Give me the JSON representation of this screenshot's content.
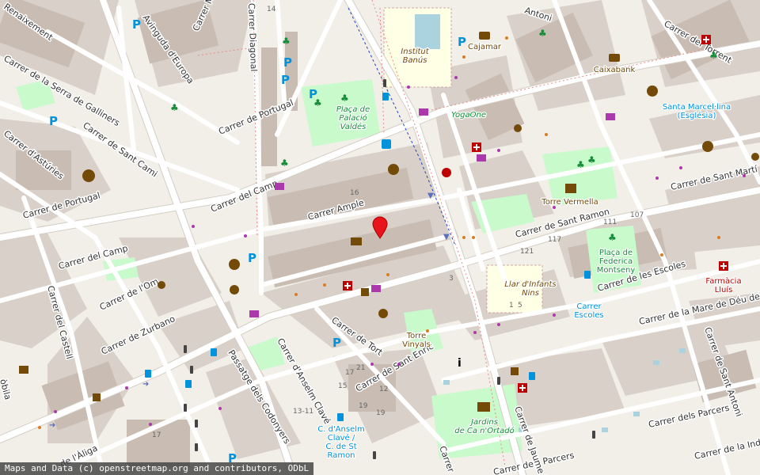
{
  "colors": {
    "background": "#f2efe9",
    "block": "#d9d0c9",
    "building": "#c9bdb3",
    "road": "#ffffff",
    "road_casing": "#d4cdc4",
    "park": "#c8facc",
    "school": "#ffffe5",
    "water": "#aad3df",
    "poi_blue": "#0092da",
    "poi_green": "#198c3a",
    "poi_brown": "#734a08",
    "health_red": "#bf0000",
    "marker_red": "#e8141b",
    "street_text": "#333333"
  },
  "streets": [
    {
      "id": "renaixement",
      "text": "Renaixement"
    },
    {
      "id": "avinguda-europa",
      "text": "Avinguda d'Europa"
    },
    {
      "id": "carrer-me",
      "text": "Carrer Me"
    },
    {
      "id": "carrer-diagonal",
      "text": "Carrer Diagonal"
    },
    {
      "id": "serra-galliners",
      "text": "Carrer de la Serra de Galliners"
    },
    {
      "id": "sant-cami",
      "text": "Carrer de Sant Cami"
    },
    {
      "id": "asturies",
      "text": "Carrer d'Astúries"
    },
    {
      "id": "portugal-north",
      "text": "Carrer de Portugal"
    },
    {
      "id": "portugal-west",
      "text": "Carrer de Portugal"
    },
    {
      "id": "camp-north",
      "text": "Carrer del Camp"
    },
    {
      "id": "camp-west",
      "text": "Carrer del Camp"
    },
    {
      "id": "ample",
      "text": "Carrer Ample"
    },
    {
      "id": "antoni-top",
      "text": "Antoni"
    },
    {
      "id": "torrent",
      "text": "Carrer del Torrent"
    },
    {
      "id": "sant-marti",
      "text": "Carrer de Sant Martí"
    },
    {
      "id": "sant-ramon",
      "text": "Carrer de Sant Ramon"
    },
    {
      "id": "escoles",
      "text": "Carrer de les Escoles"
    },
    {
      "id": "mare-deu",
      "text": "Carrer de la Mare de Déu del Pila"
    },
    {
      "id": "sant-antoni",
      "text": "Carrer de Sant Antoni"
    },
    {
      "id": "parcers-east",
      "text": "Carrer dels Parcers"
    },
    {
      "id": "parcers-south",
      "text": "Carrer dels Parcers"
    },
    {
      "id": "industria",
      "text": "Carrer de la Indú"
    },
    {
      "id": "castell",
      "text": "Carrer del Castell"
    },
    {
      "id": "om",
      "text": "Carrer de l'Om"
    },
    {
      "id": "zurbano",
      "text": "Carrer de Zurbano"
    },
    {
      "id": "codonyers",
      "text": "Passatge dels Codonyers"
    },
    {
      "id": "anselm-clave",
      "text": "Carrer d'Anselm Clavé"
    },
    {
      "id": "tort",
      "text": "Carrer de Tort"
    },
    {
      "id": "sant-enric",
      "text": "Carrer de Sant Enric"
    },
    {
      "id": "aliga",
      "text": "de l'Àliga"
    },
    {
      "id": "jaume",
      "text": "Carrer de Jaume M"
    },
    {
      "id": "carrer-s",
      "text": "Carrer"
    },
    {
      "id": "mobla",
      "text": "òbila"
    }
  ],
  "pois": [
    {
      "id": "institut-banus",
      "text": "Institut\nBanús"
    },
    {
      "id": "placa-palacio",
      "text": "Plaça de\nPalació\nValdés"
    },
    {
      "id": "cajamar",
      "text": "Cajamar"
    },
    {
      "id": "caixabank",
      "text": "Caixabank"
    },
    {
      "id": "santa-marcel-lina",
      "text": "Santa Marcel·lina\n(Església)"
    },
    {
      "id": "yogaone",
      "text": "YogaOne"
    },
    {
      "id": "torre-vermella",
      "text": "Torre Vermella"
    },
    {
      "id": "placa-federica",
      "text": "Plaça de\nFederica\nMontseny"
    },
    {
      "id": "llar-infants",
      "text": "Llar d'Infants\nNins"
    },
    {
      "id": "carrer-escoles-stop",
      "text": "Carrer\nEscoles"
    },
    {
      "id": "farmacia-lluis",
      "text": "Farmàcia\nLluís"
    },
    {
      "id": "torre-vinyals",
      "text": "Torre\nVinyals"
    },
    {
      "id": "jardins-ortado",
      "text": "Jardins\nde Ca n'Ortadó"
    },
    {
      "id": "anselm-stop",
      "text": "C. d'Anselm\nClavé /\nC. de St\nRamon"
    }
  ],
  "house_numbers": [
    "14",
    "16",
    "121",
    "117",
    "111",
    "107",
    "3",
    "1",
    "5",
    "15",
    "17",
    "21",
    "19",
    "12",
    "13-11",
    "17",
    "19"
  ],
  "marker": {
    "label": "Selected location",
    "color": "#e8141b"
  },
  "attribution": "Maps and Data (c) openstreetmap.org and contributors, ODbL"
}
